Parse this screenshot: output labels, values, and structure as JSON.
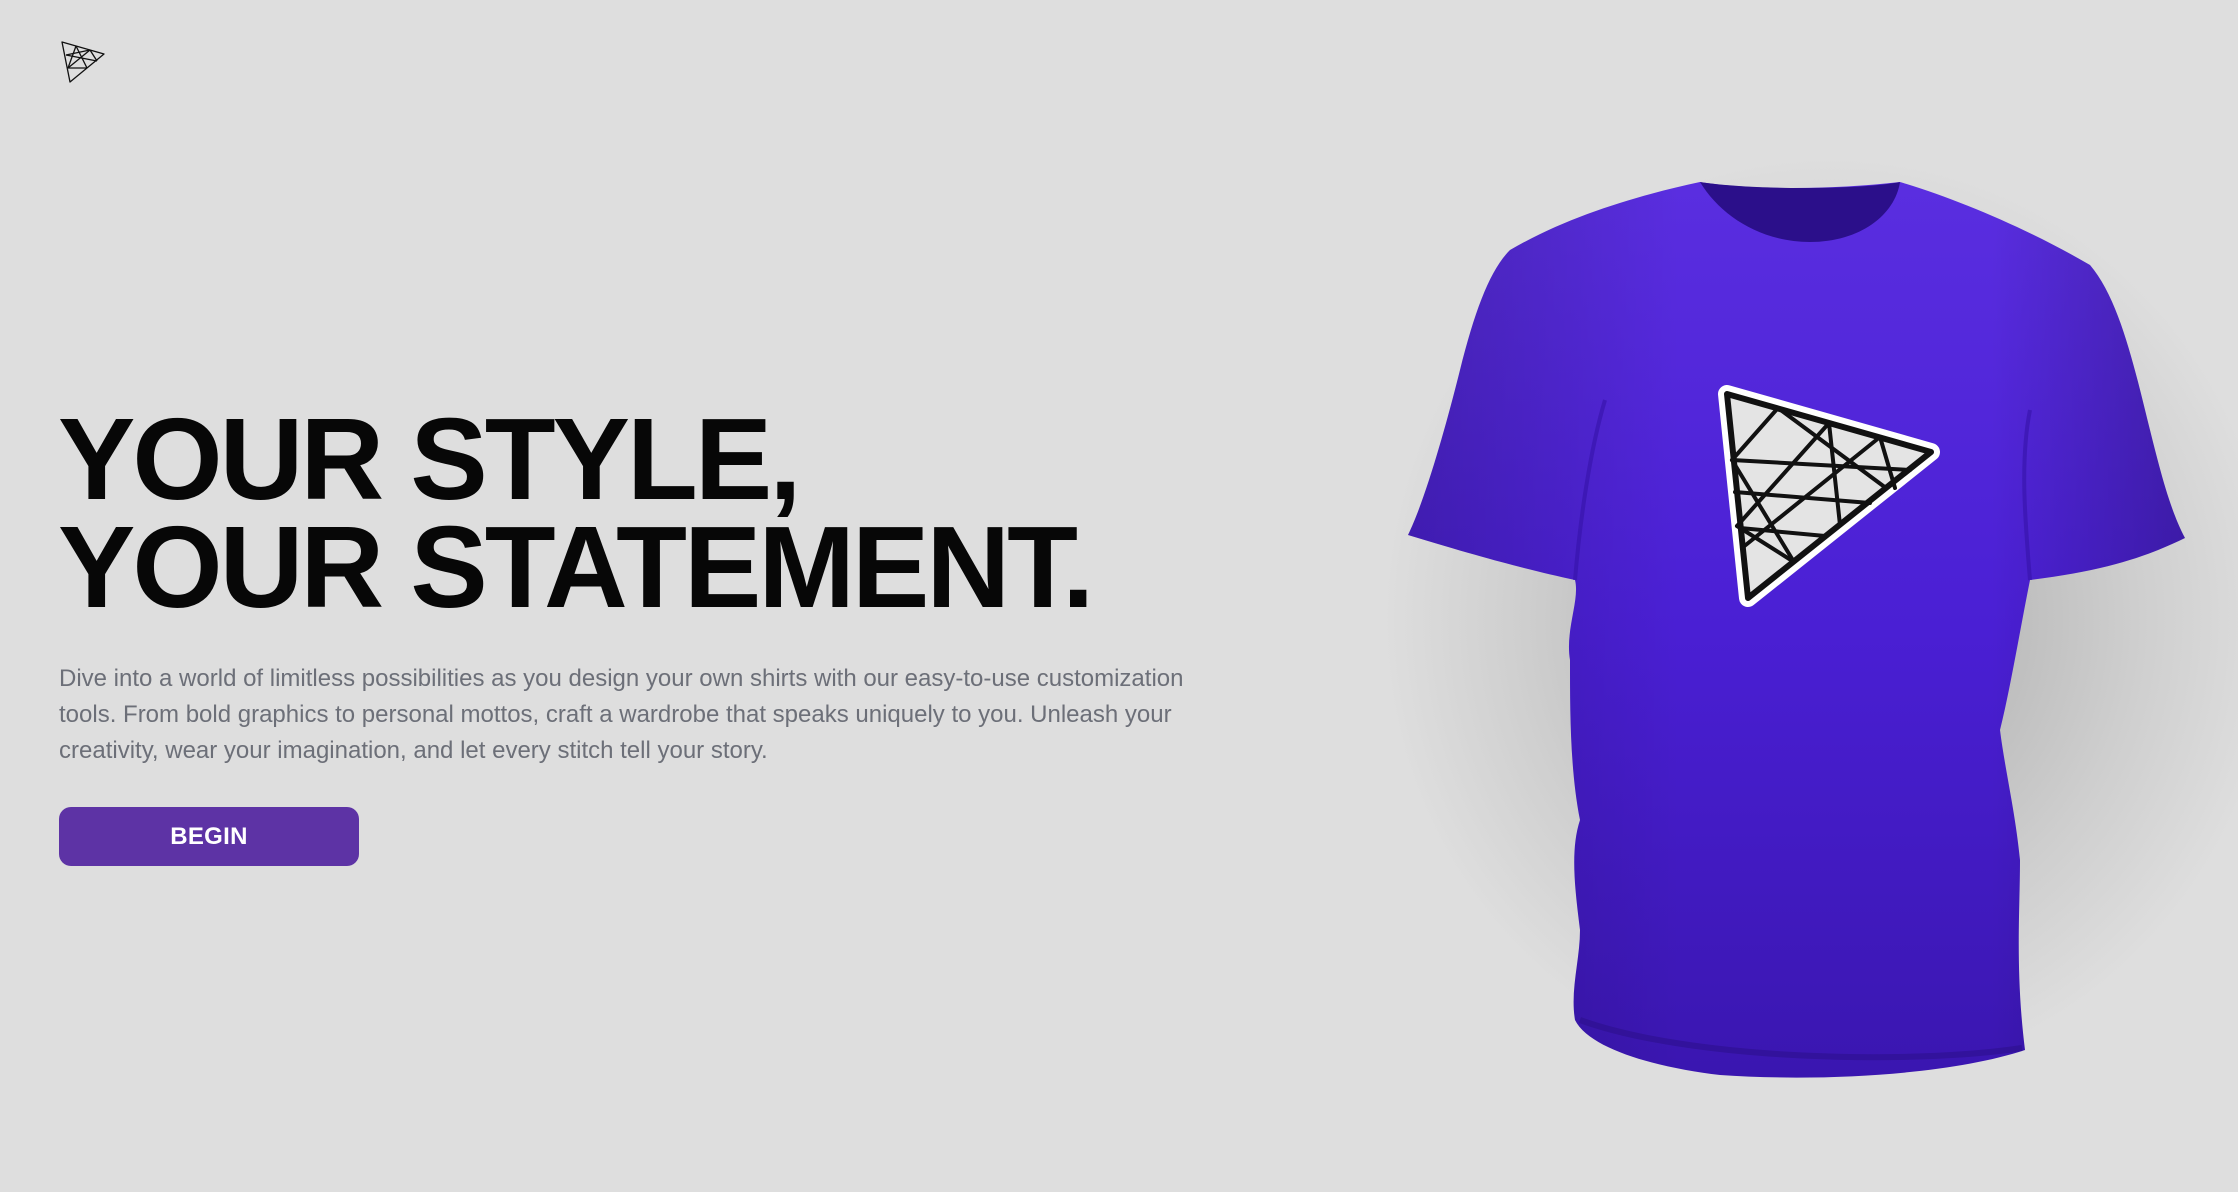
{
  "header": {
    "logo_icon": "triangle-grid-logo-icon"
  },
  "hero": {
    "headline_line1": "YOUR STYLE,",
    "headline_line2": "YOUR STATEMENT.",
    "description": "Dive into a world of limitless possibilities as you design your own shirts with our easy-to-use customization tools. From bold graphics to personal mottos, craft a wardrobe that speaks uniquely to you. Unleash your creativity, wear your imagination, and let every stitch tell your story.",
    "cta_label": "BEGIN"
  },
  "product": {
    "shirt_color": "#4a1fd4",
    "decal_icon": "triangle-grid-decal-icon"
  },
  "colors": {
    "background": "#dedede",
    "accent": "#5d33a5",
    "headline": "#070707",
    "body_text": "#6c6f78"
  }
}
